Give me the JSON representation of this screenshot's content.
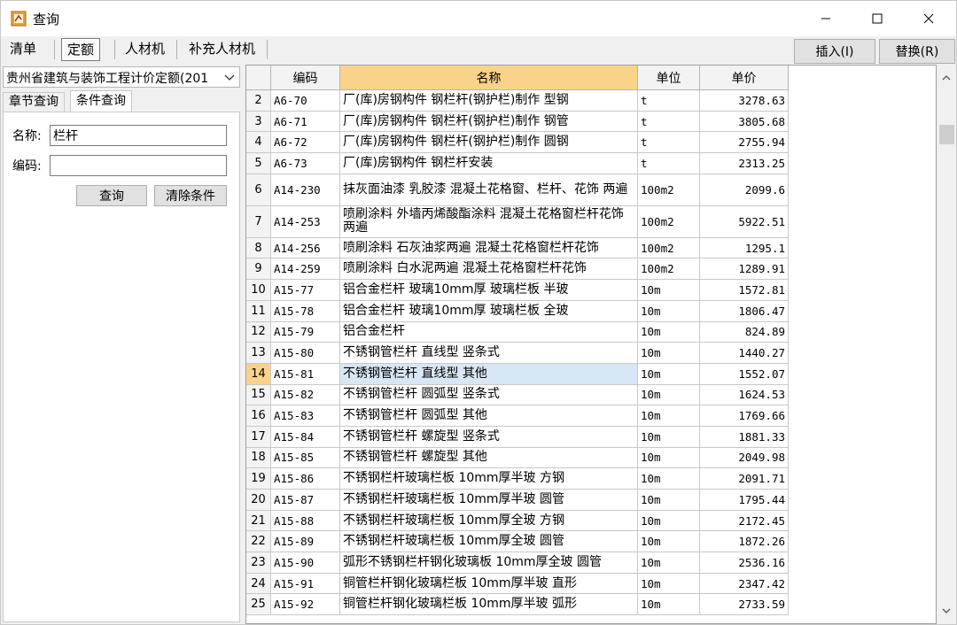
{
  "window": {
    "title": "查询"
  },
  "toolbar": {
    "tabs": [
      "清单",
      "定额",
      "人材机",
      "补充人材机"
    ],
    "insert_label": "插入(I)",
    "replace_label": "替换(R)"
  },
  "left_panel": {
    "library": "贵州省建筑与装饰工程计价定额(201",
    "tabs": [
      "章节查询",
      "条件查询"
    ],
    "name_label": "名称:",
    "name_value": "栏杆",
    "code_label": "编码:",
    "code_value": "",
    "query_button": "查询",
    "clear_button": "清除条件"
  },
  "grid": {
    "headers": [
      "",
      "编码",
      "名称",
      "单位",
      "单价"
    ],
    "selected_row": "14",
    "rows": [
      {
        "n": "2",
        "code": "A6-70",
        "name": "厂(库)房钢构件 钢栏杆(钢护栏)制作 型钢",
        "unit": "t",
        "price": "3278.63"
      },
      {
        "n": "3",
        "code": "A6-71",
        "name": "厂(库)房钢构件 钢栏杆(钢护栏)制作 钢管",
        "unit": "t",
        "price": "3805.68"
      },
      {
        "n": "4",
        "code": "A6-72",
        "name": "厂(库)房钢构件 钢栏杆(钢护栏)制作 圆钢",
        "unit": "t",
        "price": "2755.94"
      },
      {
        "n": "5",
        "code": "A6-73",
        "name": "厂(库)房钢构件 钢栏杆安装",
        "unit": "t",
        "price": "2313.25"
      },
      {
        "n": "6",
        "code": "A14-230",
        "name": "抹灰面油漆 乳胶漆 混凝土花格窗、栏杆、花饰 两遍",
        "unit": "100m2",
        "price": "2099.6"
      },
      {
        "n": "7",
        "code": "A14-253",
        "name": "喷刷涂料 外墙丙烯酸酯涂料 混凝土花格窗栏杆花饰 两遍",
        "unit": "100m2",
        "price": "5922.51"
      },
      {
        "n": "8",
        "code": "A14-256",
        "name": "喷刷涂料 石灰油浆两遍 混凝土花格窗栏杆花饰",
        "unit": "100m2",
        "price": "1295.1"
      },
      {
        "n": "9",
        "code": "A14-259",
        "name": "喷刷涂料 白水泥两遍 混凝土花格窗栏杆花饰",
        "unit": "100m2",
        "price": "1289.91"
      },
      {
        "n": "10",
        "code": "A15-77",
        "name": "铝合金栏杆 玻璃10mm厚 玻璃栏板 半玻",
        "unit": "10m",
        "price": "1572.81"
      },
      {
        "n": "11",
        "code": "A15-78",
        "name": "铝合金栏杆 玻璃10mm厚 玻璃栏板 全玻",
        "unit": "10m",
        "price": "1806.47"
      },
      {
        "n": "12",
        "code": "A15-79",
        "name": "铝合金栏杆",
        "unit": "10m",
        "price": "824.89"
      },
      {
        "n": "13",
        "code": "A15-80",
        "name": "不锈钢管栏杆 直线型 竖条式",
        "unit": "10m",
        "price": "1440.27"
      },
      {
        "n": "14",
        "code": "A15-81",
        "name": "不锈钢管栏杆 直线型 其他",
        "unit": "10m",
        "price": "1552.07"
      },
      {
        "n": "15",
        "code": "A15-82",
        "name": "不锈钢管栏杆 圆弧型 竖条式",
        "unit": "10m",
        "price": "1624.53"
      },
      {
        "n": "16",
        "code": "A15-83",
        "name": "不锈钢管栏杆 圆弧型 其他",
        "unit": "10m",
        "price": "1769.66"
      },
      {
        "n": "17",
        "code": "A15-84",
        "name": "不锈钢管栏杆 螺旋型 竖条式",
        "unit": "10m",
        "price": "1881.33"
      },
      {
        "n": "18",
        "code": "A15-85",
        "name": "不锈钢管栏杆 螺旋型 其他",
        "unit": "10m",
        "price": "2049.98"
      },
      {
        "n": "19",
        "code": "A15-86",
        "name": "不锈钢栏杆玻璃栏板 10mm厚半玻 方钢",
        "unit": "10m",
        "price": "2091.71"
      },
      {
        "n": "20",
        "code": "A15-87",
        "name": "不锈钢栏杆玻璃栏板 10mm厚半玻 圆管",
        "unit": "10m",
        "price": "1795.44"
      },
      {
        "n": "21",
        "code": "A15-88",
        "name": "不锈钢栏杆玻璃栏板 10mm厚全玻 方钢",
        "unit": "10m",
        "price": "2172.45"
      },
      {
        "n": "22",
        "code": "A15-89",
        "name": "不锈钢栏杆玻璃栏板 10mm厚全玻 圆管",
        "unit": "10m",
        "price": "1872.26"
      },
      {
        "n": "23",
        "code": "A15-90",
        "name": "弧形不锈钢栏杆钢化玻璃板 10mm厚全玻 圆管",
        "unit": "10m",
        "price": "2536.16"
      },
      {
        "n": "24",
        "code": "A15-91",
        "name": "铜管栏杆钢化玻璃栏板 10mm厚半玻 直形",
        "unit": "10m",
        "price": "2347.42"
      },
      {
        "n": "25",
        "code": "A15-92",
        "name": "铜管栏杆钢化玻璃栏板 10mm厚半玻 弧形",
        "unit": "10m",
        "price": "2733.59"
      }
    ]
  },
  "colors": {
    "header_sorted": "#f9d38a",
    "selected_row": "#d8e7f5"
  },
  "icons": {
    "app": "ledger-icon",
    "minimize": "minimize-icon",
    "maximize": "maximize-icon",
    "close": "close-icon"
  }
}
